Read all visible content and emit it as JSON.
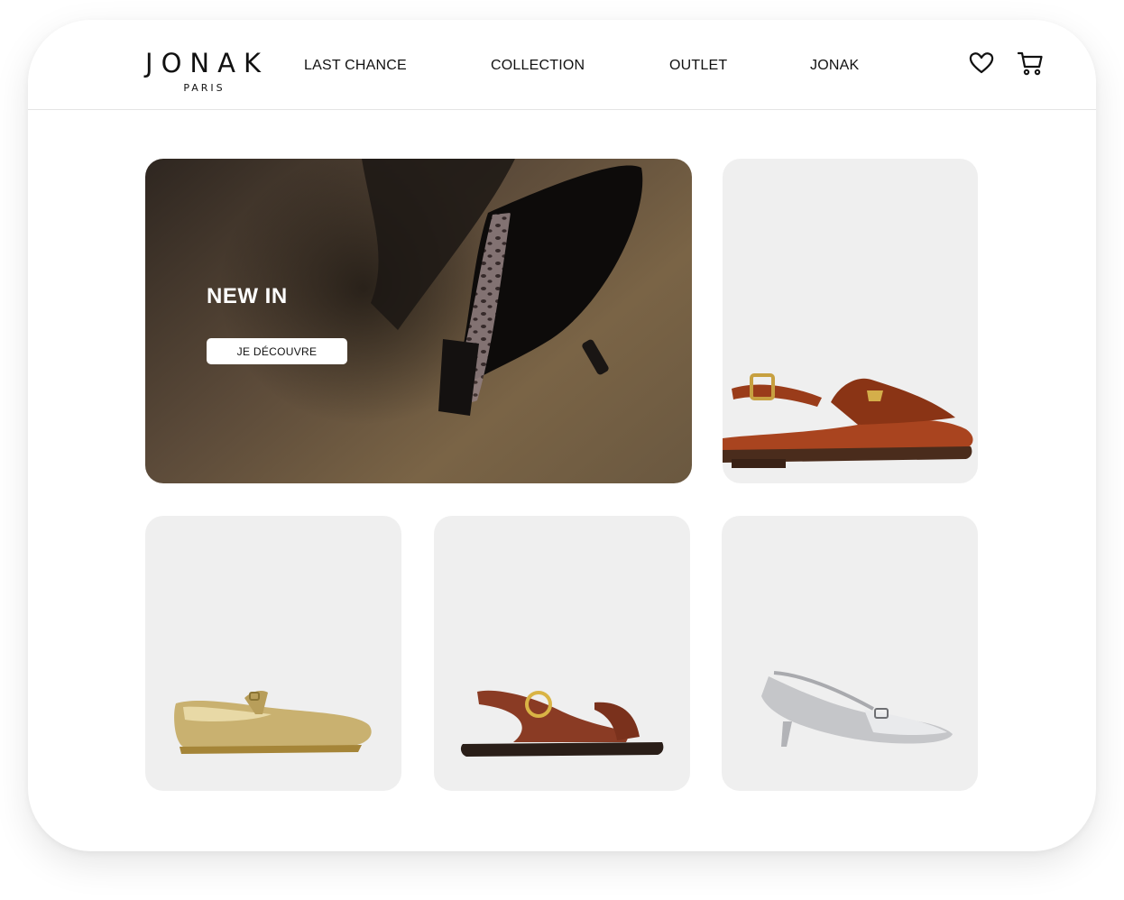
{
  "brand": {
    "name": "JONAK",
    "subtitle": "PARIS"
  },
  "nav": {
    "items": [
      {
        "label": "LAST CHANCE"
      },
      {
        "label": "COLLECTION"
      },
      {
        "label": "OUTLET"
      },
      {
        "label": "JONAK"
      }
    ]
  },
  "header_icons": {
    "wishlist": "heart-icon",
    "cart": "shopping-cart-icon"
  },
  "hero": {
    "title": "NEW IN",
    "button_label": "JE DÉCOUVRE"
  },
  "products": [
    {
      "image": "brown-slingback-loafer"
    },
    {
      "image": "gold-mary-jane-flat"
    },
    {
      "image": "brown-buckle-sandal"
    },
    {
      "image": "silver-kitten-heel-slingback"
    }
  ],
  "colors": {
    "card_bg": "#efefef",
    "text": "#111111",
    "hero_button_bg": "#ffffff"
  }
}
